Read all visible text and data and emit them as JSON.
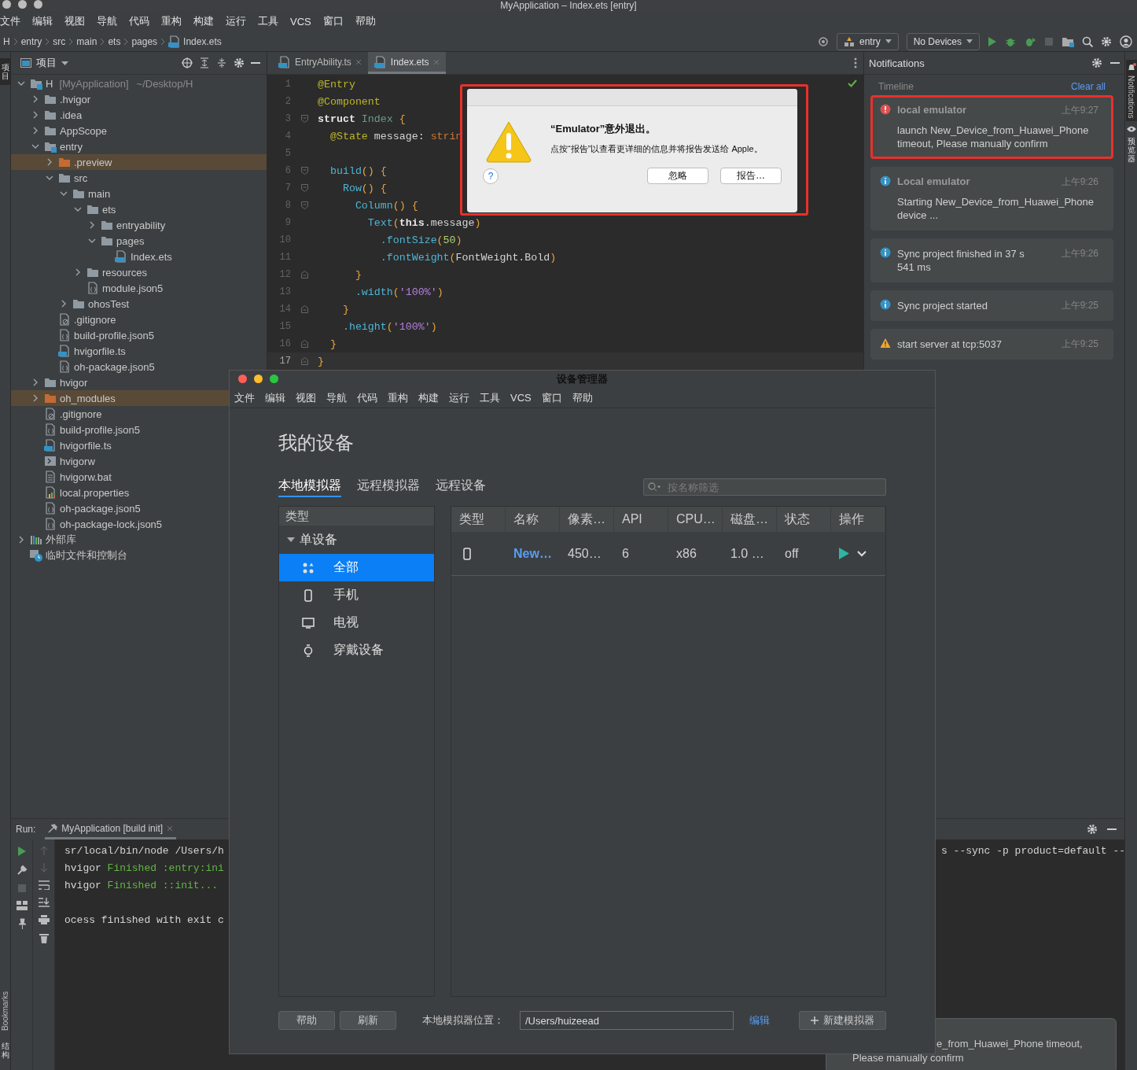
{
  "window_title": "MyApplication – Index.ets [entry]",
  "menu": [
    "文件",
    "编辑",
    "视图",
    "导航",
    "代码",
    "重构",
    "构建",
    "运行",
    "工具",
    "VCS",
    "窗口",
    "帮助"
  ],
  "breadcrumbs": [
    "H",
    "entry",
    "src",
    "main",
    "ets",
    "pages",
    "Index.ets"
  ],
  "toolbar": {
    "config": "entry",
    "device": "No Devices"
  },
  "left_strip": {
    "project": "项目",
    "bookmarks": "Bookmarks",
    "structure": "结构"
  },
  "project": {
    "title": "项目",
    "tree": [
      {
        "label": "H",
        "qualifier": "[MyApplication]",
        "path": "~/Desktop/H",
        "kind": "module",
        "expanded": true,
        "children": [
          {
            "label": ".hvigor",
            "kind": "folder",
            "expanded": false
          },
          {
            "label": ".idea",
            "kind": "folder",
            "expanded": false
          },
          {
            "label": "AppScope",
            "kind": "folder",
            "expanded": false
          },
          {
            "label": "entry",
            "kind": "module",
            "expanded": true,
            "children": [
              {
                "label": ".preview",
                "kind": "excluded-folder",
                "expanded": false
              },
              {
                "label": "src",
                "kind": "folder",
                "expanded": true,
                "children": [
                  {
                    "label": "main",
                    "kind": "folder",
                    "expanded": true,
                    "children": [
                      {
                        "label": "ets",
                        "kind": "folder",
                        "expanded": true,
                        "children": [
                          {
                            "label": "entryability",
                            "kind": "folder",
                            "expanded": false
                          },
                          {
                            "label": "pages",
                            "kind": "folder",
                            "expanded": true,
                            "children": [
                              {
                                "label": "Index.ets",
                                "kind": "ets"
                              }
                            ]
                          }
                        ]
                      },
                      {
                        "label": "resources",
                        "kind": "folder",
                        "expanded": false
                      },
                      {
                        "label": "module.json5",
                        "kind": "json"
                      }
                    ]
                  },
                  {
                    "label": "ohosTest",
                    "kind": "folder",
                    "expanded": false
                  }
                ]
              },
              {
                "label": ".gitignore",
                "kind": "git"
              },
              {
                "label": "build-profile.json5",
                "kind": "json"
              },
              {
                "label": "hvigorfile.ts",
                "kind": "ts"
              },
              {
                "label": "oh-package.json5",
                "kind": "json"
              }
            ]
          },
          {
            "label": "hvigor",
            "kind": "folder",
            "expanded": false
          },
          {
            "label": "oh_modules",
            "kind": "excluded-folder",
            "expanded": false
          },
          {
            "label": ".gitignore",
            "kind": "git"
          },
          {
            "label": "build-profile.json5",
            "kind": "json"
          },
          {
            "label": "hvigorfile.ts",
            "kind": "ts"
          },
          {
            "label": "hvigorw",
            "kind": "shell"
          },
          {
            "label": "hvigorw.bat",
            "kind": "text"
          },
          {
            "label": "local.properties",
            "kind": "properties"
          },
          {
            "label": "oh-package.json5",
            "kind": "json"
          },
          {
            "label": "oh-package-lock.json5",
            "kind": "json"
          }
        ]
      },
      {
        "label": "外部库",
        "kind": "library",
        "expanded": false
      },
      {
        "label": "临时文件和控制台",
        "kind": "scratch"
      }
    ]
  },
  "editor": {
    "tabs": [
      {
        "label": "EntryAbility.ts",
        "kind": "ts",
        "selected": false
      },
      {
        "label": "Index.ets",
        "kind": "ets",
        "selected": true
      }
    ],
    "lines": [
      {
        "n": "1",
        "current": false,
        "kind": "plain",
        "tokens": [
          {
            "t": "@Entry",
            "kind": "ann"
          }
        ]
      },
      {
        "n": "2",
        "current": false,
        "kind": "plain",
        "tokens": [
          {
            "t": "@Component",
            "kind": "ann"
          }
        ]
      },
      {
        "n": "3",
        "current": false,
        "kind": "fold-start",
        "tokens": [
          {
            "t": "struct ",
            "kind": "kw"
          },
          {
            "t": "Index ",
            "kind": "type"
          },
          {
            "t": "{",
            "kind": "brace"
          }
        ]
      },
      {
        "n": "4",
        "current": false,
        "kind": "plain",
        "tokens": [
          {
            "t": "  @State",
            "kind": "ann"
          },
          {
            "t": " message: ",
            "kind": "plain"
          },
          {
            "t": "strin",
            "kind": "builtin"
          }
        ]
      },
      {
        "n": "5",
        "current": false,
        "kind": "plain"
      },
      {
        "n": "6",
        "current": false,
        "kind": "fold-start",
        "tokens": [
          {
            "t": "  build",
            "kind": "fn"
          },
          {
            "t": "() {",
            "kind": "brace"
          }
        ]
      },
      {
        "n": "7",
        "current": false,
        "kind": "fold-start",
        "tokens": [
          {
            "t": "    Row",
            "kind": "fn"
          },
          {
            "t": "() {",
            "kind": "brace"
          }
        ]
      },
      {
        "n": "8",
        "current": false,
        "kind": "fold-start",
        "tokens": [
          {
            "t": "      Column",
            "kind": "fn"
          },
          {
            "t": "() {",
            "kind": "brace"
          }
        ]
      },
      {
        "n": "9",
        "current": false,
        "kind": "plain",
        "tokens": [
          {
            "t": "        Text",
            "kind": "fn"
          },
          {
            "t": "(",
            "kind": "brace"
          },
          {
            "t": "this",
            "kind": "kw"
          },
          {
            "t": ".message",
            "kind": "plain"
          },
          {
            "t": ")",
            "kind": "brace"
          }
        ]
      },
      {
        "n": "10",
        "current": false,
        "kind": "plain",
        "tokens": [
          {
            "t": "          .fontSize",
            "kind": "fn"
          },
          {
            "t": "(",
            "kind": "brace"
          },
          {
            "t": "50",
            "kind": "num"
          },
          {
            "t": ")",
            "kind": "brace"
          }
        ]
      },
      {
        "n": "11",
        "current": false,
        "kind": "plain",
        "tokens": [
          {
            "t": "          .fontWeight",
            "kind": "fn"
          },
          {
            "t": "(",
            "kind": "brace"
          },
          {
            "t": "FontWeight.Bold",
            "kind": "plain"
          },
          {
            "t": ")",
            "kind": "brace"
          }
        ]
      },
      {
        "n": "12",
        "current": false,
        "kind": "fold-end",
        "tokens": [
          {
            "t": "      }",
            "kind": "brace"
          }
        ]
      },
      {
        "n": "13",
        "current": false,
        "kind": "plain",
        "tokens": [
          {
            "t": "      .width",
            "kind": "fn"
          },
          {
            "t": "(",
            "kind": "brace"
          },
          {
            "t": "'100%'",
            "kind": "str"
          },
          {
            "t": ")",
            "kind": "brace"
          }
        ]
      },
      {
        "n": "14",
        "current": false,
        "kind": "fold-end",
        "tokens": [
          {
            "t": "    }",
            "kind": "brace"
          }
        ]
      },
      {
        "n": "15",
        "current": false,
        "kind": "plain",
        "tokens": [
          {
            "t": "    .height",
            "kind": "fn"
          },
          {
            "t": "(",
            "kind": "brace"
          },
          {
            "t": "'100%'",
            "kind": "str"
          },
          {
            "t": ")",
            "kind": "brace"
          }
        ]
      },
      {
        "n": "16",
        "current": false,
        "kind": "fold-end",
        "tokens": [
          {
            "t": "  }",
            "kind": "brace"
          }
        ]
      },
      {
        "n": "17",
        "current": true,
        "kind": "fold-end",
        "tokens": [
          {
            "t": "}",
            "kind": "brace"
          }
        ]
      }
    ]
  },
  "dialog": {
    "title": "“Emulator”意外退出。",
    "message": "点按“报告”以查看更详细的信息并将报告发送给 Apple。",
    "help": "?",
    "buttons": [
      "忽略",
      "报告…"
    ]
  },
  "notifications": {
    "title": "Notifications",
    "section": "Timeline",
    "clear": "Clear all",
    "items": [
      {
        "kind": "error",
        "title": "local emulator",
        "message": "launch New_Device_from_Huawei_Phone timeout, Please manually confirm",
        "time": "上午9:27",
        "highlighted": true
      },
      {
        "kind": "info",
        "title": "Local emulator",
        "message": "Starting New_Device_from_Huawei_Phone device ...",
        "time": "上午9:26",
        "highlighted": false
      },
      {
        "kind": "info",
        "message": "Sync project finished in 37 s 541 ms",
        "time": "上午9:26",
        "highlighted": false
      },
      {
        "kind": "info",
        "message": "Sync project started",
        "time": "上午9:25",
        "highlighted": false
      },
      {
        "kind": "warning",
        "message": "start server at tcp:5037",
        "time": "上午9:25",
        "highlighted": false
      }
    ]
  },
  "right_strip": {
    "notifications": "Notifications",
    "preview": "预览器"
  },
  "run": {
    "label": "Run:",
    "tab": "MyApplication [build init]",
    "console": [
      {
        "kind": "text",
        "prefix": "sr/local/bin/node /Users/h"
      },
      {
        "kind": "text",
        "prefix": "hvigor ",
        "highlight": "Finished :entry:ini"
      },
      {
        "kind": "text",
        "prefix": "hvigor ",
        "highlight": "Finished ::init... "
      },
      {
        "kind": "blank"
      },
      {
        "kind": "text",
        "prefix": "ocess finished with exit c"
      }
    ],
    "console_right": "s --sync -p product=default --"
  },
  "toast": {
    "lines": [
      "e_from_Huawei_Phone timeout,",
      "Please manually confirm"
    ]
  },
  "device_manager": {
    "title": "设备管理器",
    "menu": [
      "文件",
      "编辑",
      "视图",
      "导航",
      "代码",
      "重构",
      "构建",
      "运行",
      "工具",
      "VCS",
      "窗口",
      "帮助"
    ],
    "heading": "我的设备",
    "tabs": [
      {
        "label": "本地模拟器",
        "selected": true
      },
      {
        "label": "远程模拟器",
        "selected": false
      },
      {
        "label": "远程设备",
        "selected": false
      }
    ],
    "filter_placeholder": "按名称筛选",
    "sidebar": {
      "header": "类型",
      "group": "单设备",
      "expanded": true,
      "items": [
        {
          "label": "全部",
          "kind": "all",
          "selected": true
        },
        {
          "label": "手机",
          "kind": "phone",
          "selected": false
        },
        {
          "label": "电视",
          "kind": "tv",
          "selected": false
        },
        {
          "label": "穿戴设备",
          "kind": "watch",
          "selected": false
        }
      ]
    },
    "table": {
      "columns": [
        "类型",
        "名称",
        "像素…",
        "API",
        "CPU…",
        "磁盘…",
        "状态",
        "操作"
      ],
      "rows": [
        {
          "kind": "phone",
          "name": "New…",
          "pixels": "450…",
          "api": "6",
          "cpu": "x86",
          "disk": "1.0 …",
          "status": "off"
        }
      ]
    },
    "footer": {
      "buttons": [
        "帮助",
        "刷新"
      ],
      "location_label": "本地模拟器位置：",
      "location_value": "/Users/huizeead",
      "edit_link": "编辑",
      "new_button": "新建模拟器"
    }
  }
}
